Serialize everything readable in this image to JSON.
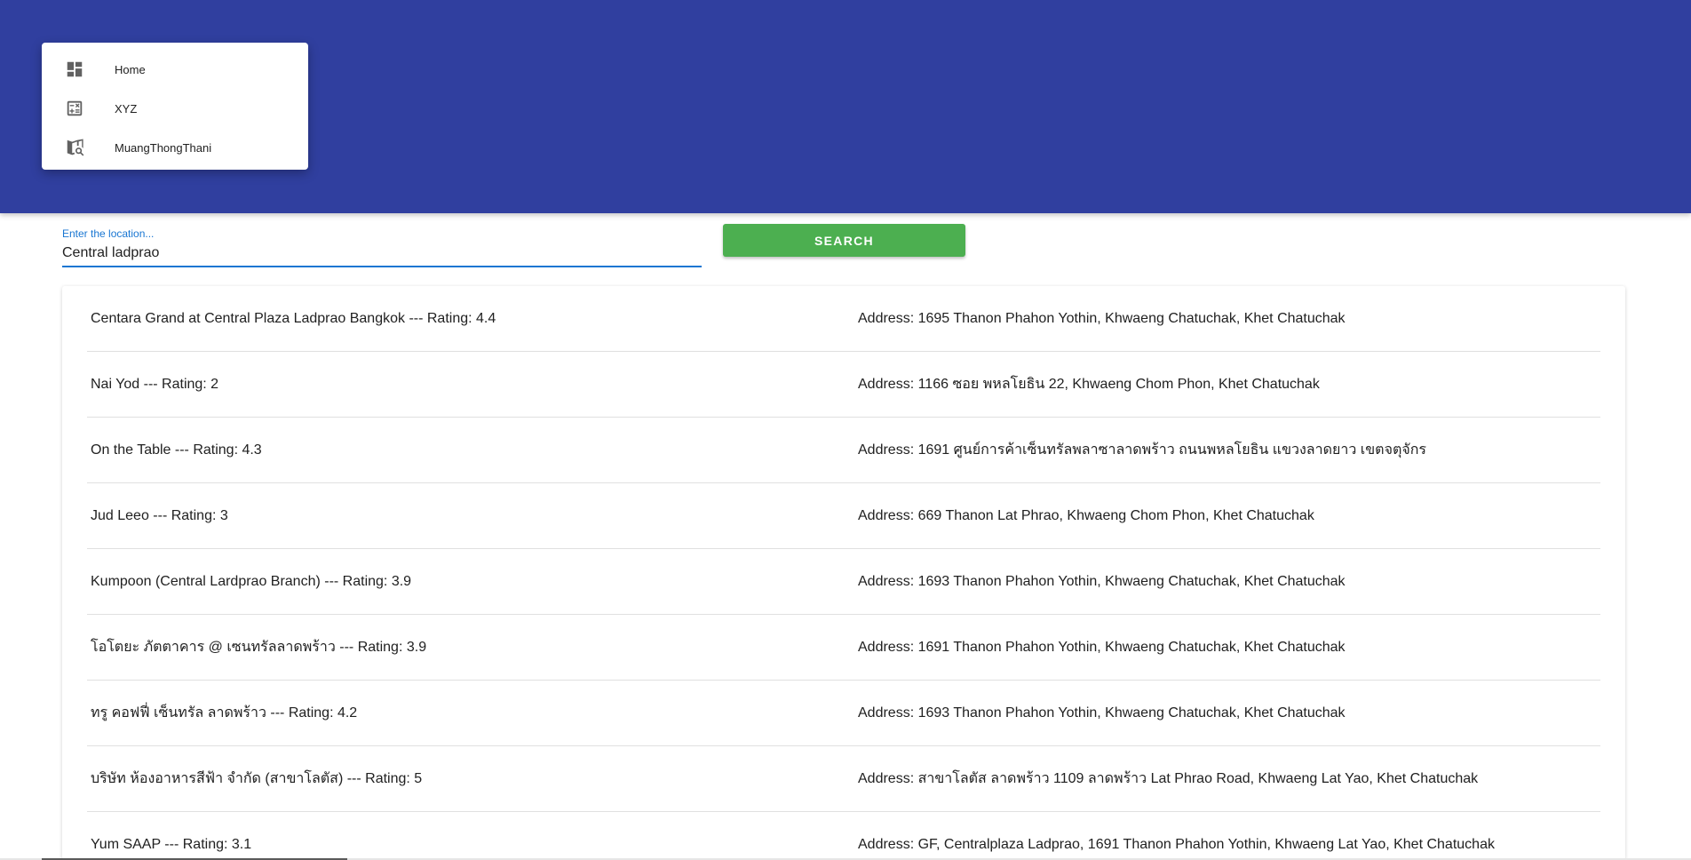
{
  "colors": {
    "header_bg": "#303f9f",
    "accent_blue": "#1976d2",
    "search_button_bg": "#4caf50",
    "icon_gray": "#616161"
  },
  "nav_menu": {
    "items": [
      {
        "label": "Home",
        "icon": "dashboard-icon"
      },
      {
        "label": "XYZ",
        "icon": "calculator-icon"
      },
      {
        "label": "MuangThongThani",
        "icon": "map-search-icon"
      }
    ]
  },
  "search": {
    "label": "Enter the location...",
    "value": "Central ladprao",
    "button_label": "SEARCH"
  },
  "results": [
    {
      "name": "Centara Grand at Central Plaza Ladprao Bangkok --- Rating: 4.4",
      "address": "Address: 1695 Thanon Phahon Yothin, Khwaeng Chatuchak, Khet Chatuchak"
    },
    {
      "name": "Nai Yod --- Rating: 2",
      "address": "Address: 1166 ซอย พหลโยธิน 22, Khwaeng Chom Phon, Khet Chatuchak"
    },
    {
      "name": "On the Table --- Rating: 4.3",
      "address": "Address: 1691 ศูนย์การค้าเซ็นทรัลพลาซาลาดพร้าว ถนนพหลโยธิน แขวงลาดยาว เขตจตุจักร"
    },
    {
      "name": "Jud Leeo --- Rating: 3",
      "address": "Address: 669 Thanon Lat Phrao, Khwaeng Chom Phon, Khet Chatuchak"
    },
    {
      "name": "Kumpoon (Central Lardprao Branch) --- Rating: 3.9",
      "address": "Address: 1693 Thanon Phahon Yothin, Khwaeng Chatuchak, Khet Chatuchak"
    },
    {
      "name": "โอโตยะ ภัตตาคาร @ เซนทรัลลาดพร้าว --- Rating: 3.9",
      "address": "Address: 1691 Thanon Phahon Yothin, Khwaeng Chatuchak, Khet Chatuchak"
    },
    {
      "name": "ทรู คอฟฟี่ เซ็นทรัล ลาดพร้าว --- Rating: 4.2",
      "address": "Address: 1693 Thanon Phahon Yothin, Khwaeng Chatuchak, Khet Chatuchak"
    },
    {
      "name": "บริษัท ห้องอาหารสีฟ้า จำกัด (สาขาโลตัส) --- Rating: 5",
      "address": "Address: สาขาโลตัส ลาดพร้าว 1109 ลาดพร้าว Lat Phrao Road, Khwaeng Lat Yao, Khet Chatuchak"
    },
    {
      "name": "Yum SAAP --- Rating: 3.1",
      "address": "Address: GF, Centralplaza Ladprao, 1691 Thanon Phahon Yothin, Khwaeng Lat Yao, Khet Chatuchak"
    }
  ]
}
